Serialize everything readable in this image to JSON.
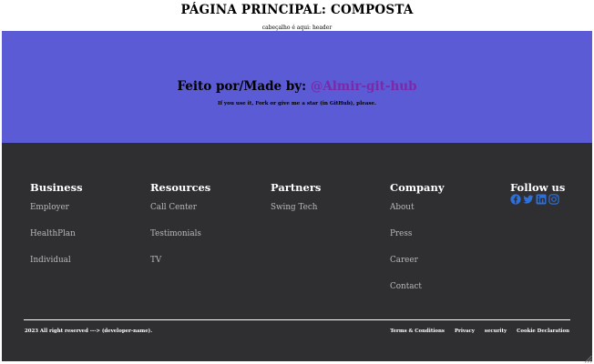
{
  "page": {
    "title": "PÁGINA PRINCIPAL: COMPOSTA",
    "header_note": "cabeçalho é aqui: header"
  },
  "hero": {
    "made_by": "Feito por/Made by: ",
    "author": "@Almir-git-hub",
    "subtitle": "If you use it, Fork or give me a star (in GitHub), please.",
    "bg_color": "#5b5bd6",
    "link_color": "#7a2aa8"
  },
  "footer": {
    "bg_color": "#2f2e31",
    "columns": [
      {
        "title": "Business",
        "links": [
          "Employer",
          "HealthPlan",
          "Individual"
        ]
      },
      {
        "title": "Resources",
        "links": [
          "Call Center",
          "Testimonials",
          "TV"
        ]
      },
      {
        "title": "Partners",
        "links": [
          "Swing Tech"
        ]
      },
      {
        "title": "Company",
        "links": [
          "About",
          "Press",
          "Career",
          "Contact"
        ]
      }
    ],
    "follow": {
      "title": "Follow us",
      "icons": [
        "facebook-icon",
        "twitter-icon",
        "linkedin-icon",
        "instagram-icon"
      ],
      "icon_color": "#2f6fd6"
    },
    "copyright": "2023 All right reserved ---> (developer-name).",
    "legal_links": [
      "Terms & Conditions",
      "Privacy",
      "security",
      "Cookie Declaration"
    ]
  }
}
